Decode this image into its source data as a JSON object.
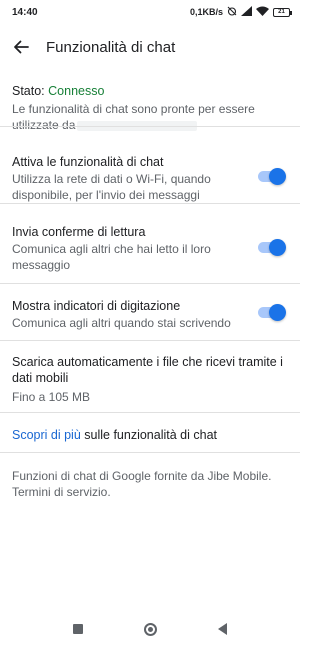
{
  "status_bar": {
    "time": "14:40",
    "speed": "0,1KB/s",
    "battery": "21",
    "icons": [
      "alarm-off-icon",
      "wifi-icon",
      "signal-icon",
      "battery-icon"
    ]
  },
  "toolbar": {
    "title": "Funzionalità di chat",
    "back_icon": "arrow-back-icon"
  },
  "status": {
    "label": "Stato: ",
    "value": "Connesso",
    "description": "Le funzionalità di chat sono pronte per essere utilizzate da"
  },
  "settings": [
    {
      "title": "Attiva le funzionalità di chat",
      "subtitle": "Utilizza la rete di dati o Wi-Fi, quando disponibile, per l'invio dei messaggi",
      "toggle": true
    },
    {
      "title": "Invia conferme di lettura",
      "subtitle": "Comunica agli altri che hai letto il loro messaggio",
      "toggle": true
    },
    {
      "title": "Mostra indicatori di digitazione",
      "subtitle": "Comunica agli altri quando stai scrivendo",
      "toggle": true
    },
    {
      "title": "Scarica automaticamente i file che ricevi tramite i dati mobili",
      "subtitle": "Fino a 105 MB"
    }
  ],
  "learn_more": {
    "link": "Scopri di più",
    "rest": " sulle funzionalità di chat"
  },
  "footer": {
    "text": "Funzioni di chat di Google fornite da Jibe Mobile. Termini di servizio."
  },
  "nav": {
    "recents": "square-icon",
    "home": "circle-icon",
    "back": "triangle-back-icon"
  },
  "colors": {
    "accent": "#1a73e8",
    "connected": "#188038",
    "link": "#1967d2"
  }
}
